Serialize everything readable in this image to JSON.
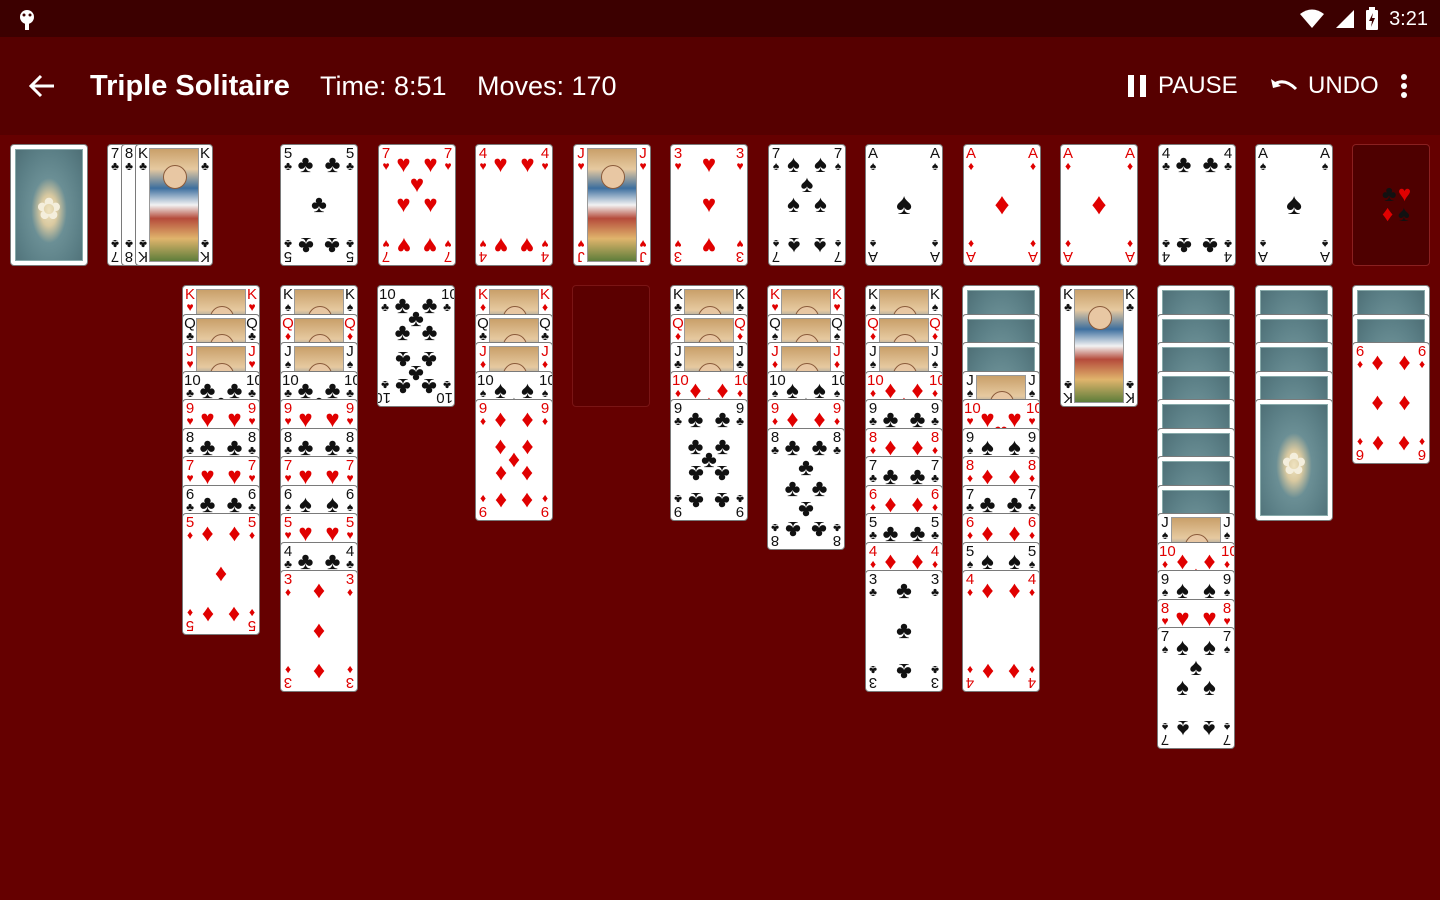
{
  "status_bar": {
    "clock": "3:21"
  },
  "app_bar": {
    "title": "Triple Solitaire",
    "time": "Time: 8:51",
    "moves": "Moves: 170",
    "pause_label": "PAUSE",
    "undo_label": "UNDO"
  },
  "colors": {
    "felt": "#650000",
    "app_bar": "#560000",
    "status_bar": "#3c0000",
    "red_suit": "#e00000",
    "black_suit": "#111111"
  },
  "stock": {
    "face_down": true
  },
  "waste": [
    "7♣",
    "8♣",
    "K♣"
  ],
  "foundations": [
    "5♣",
    "7♥",
    "4♥",
    "J♥",
    "3♥",
    "7♠",
    "A♠",
    "A♦",
    "A♦",
    "4♣",
    "A♠"
  ],
  "tableau": [
    {
      "face_down": 0,
      "cards": [
        "K♥",
        "Q♣",
        "J♥",
        "10♣",
        "9♥",
        "8♣",
        "7♥",
        "6♣",
        "5♦"
      ]
    },
    {
      "face_down": 0,
      "cards": [
        "K♠",
        "Q♦",
        "J♠",
        "10♣",
        "9♥",
        "8♣",
        "7♥",
        "6♠",
        "5♥",
        "4♣",
        "3♦"
      ]
    },
    {
      "face_down": 0,
      "cards": [
        "10♣"
      ]
    },
    {
      "face_down": 0,
      "cards": [
        "K♦",
        "Q♣",
        "J♦",
        "10♠",
        "9♦"
      ]
    },
    {
      "face_down": 0,
      "cards": []
    },
    {
      "face_down": 0,
      "cards": [
        "K♣",
        "Q♦",
        "J♣",
        "10♦",
        "9♣"
      ]
    },
    {
      "face_down": 0,
      "cards": [
        "K♥",
        "Q♠",
        "J♦",
        "10♠",
        "9♦",
        "8♣"
      ]
    },
    {
      "face_down": 0,
      "cards": [
        "K♠",
        "Q♦",
        "J♠",
        "10♦",
        "9♣",
        "8♦",
        "7♣",
        "6♦",
        "5♣",
        "4♦",
        "3♣"
      ]
    },
    {
      "face_down": 3,
      "cards": [
        "J♠",
        "10♥",
        "9♠",
        "8♦",
        "7♣",
        "6♦",
        "5♠",
        "4♦"
      ]
    },
    {
      "face_down": 0,
      "cards": [
        "K♣"
      ]
    },
    {
      "face_down": 8,
      "cards": [
        "J♠",
        "10♦",
        "9♠",
        "8♥",
        "7♠"
      ]
    },
    {
      "face_down": 5,
      "cards": []
    },
    {
      "face_down": 2,
      "cards": [
        "6♦"
      ]
    }
  ]
}
